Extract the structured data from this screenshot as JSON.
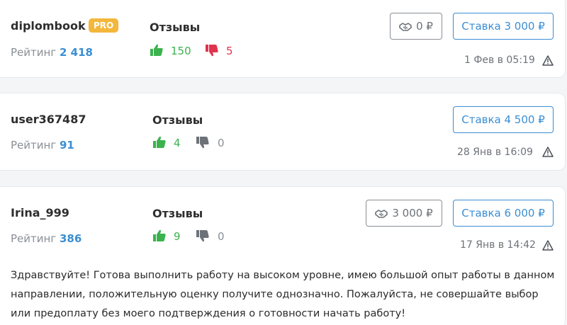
{
  "bids": [
    {
      "username": "diplombook",
      "badge": "PRO",
      "rating_label": "Рейтинг",
      "rating_value": "2 418",
      "reviews_label": "Отзывы",
      "positive": "150",
      "negative": "5",
      "deal_label": "0 ₽",
      "bid_label": "Ставка 3 000 ₽",
      "date": "1 Фев в 05:19"
    },
    {
      "username": "user367487",
      "rating_label": "Рейтинг",
      "rating_value": "91",
      "reviews_label": "Отзывы",
      "positive": "4",
      "negative": "0",
      "bid_label": "Ставка 4 500 ₽",
      "date": "28 Янв в 16:09"
    },
    {
      "username": "Irina_999",
      "rating_label": "Рейтинг",
      "rating_value": "386",
      "reviews_label": "Отзывы",
      "positive": "9",
      "negative": "0",
      "deal_label": "3 000 ₽",
      "bid_label": "Ставка 6 000 ₽",
      "date": "17 Янв в 14:42",
      "message": "Здравствуйте! Готова выполнить работу на высоком уровне, имею большой опыт работы в данном направлении, положительную оценку получите однозначно. Пожалуйста, не совершайте выбор или предоплату без моего подтверждения о готовности начать работу!"
    }
  ],
  "colors": {
    "accent": "#3a8ed3",
    "positive": "#3bb24e",
    "negative": "#e0334e",
    "neutral": "#8a8f96",
    "pro_badge": "#f3b73b"
  },
  "icons": [
    "thumbs-up-icon",
    "thumbs-down-icon",
    "handshake-icon",
    "warning-icon"
  ]
}
